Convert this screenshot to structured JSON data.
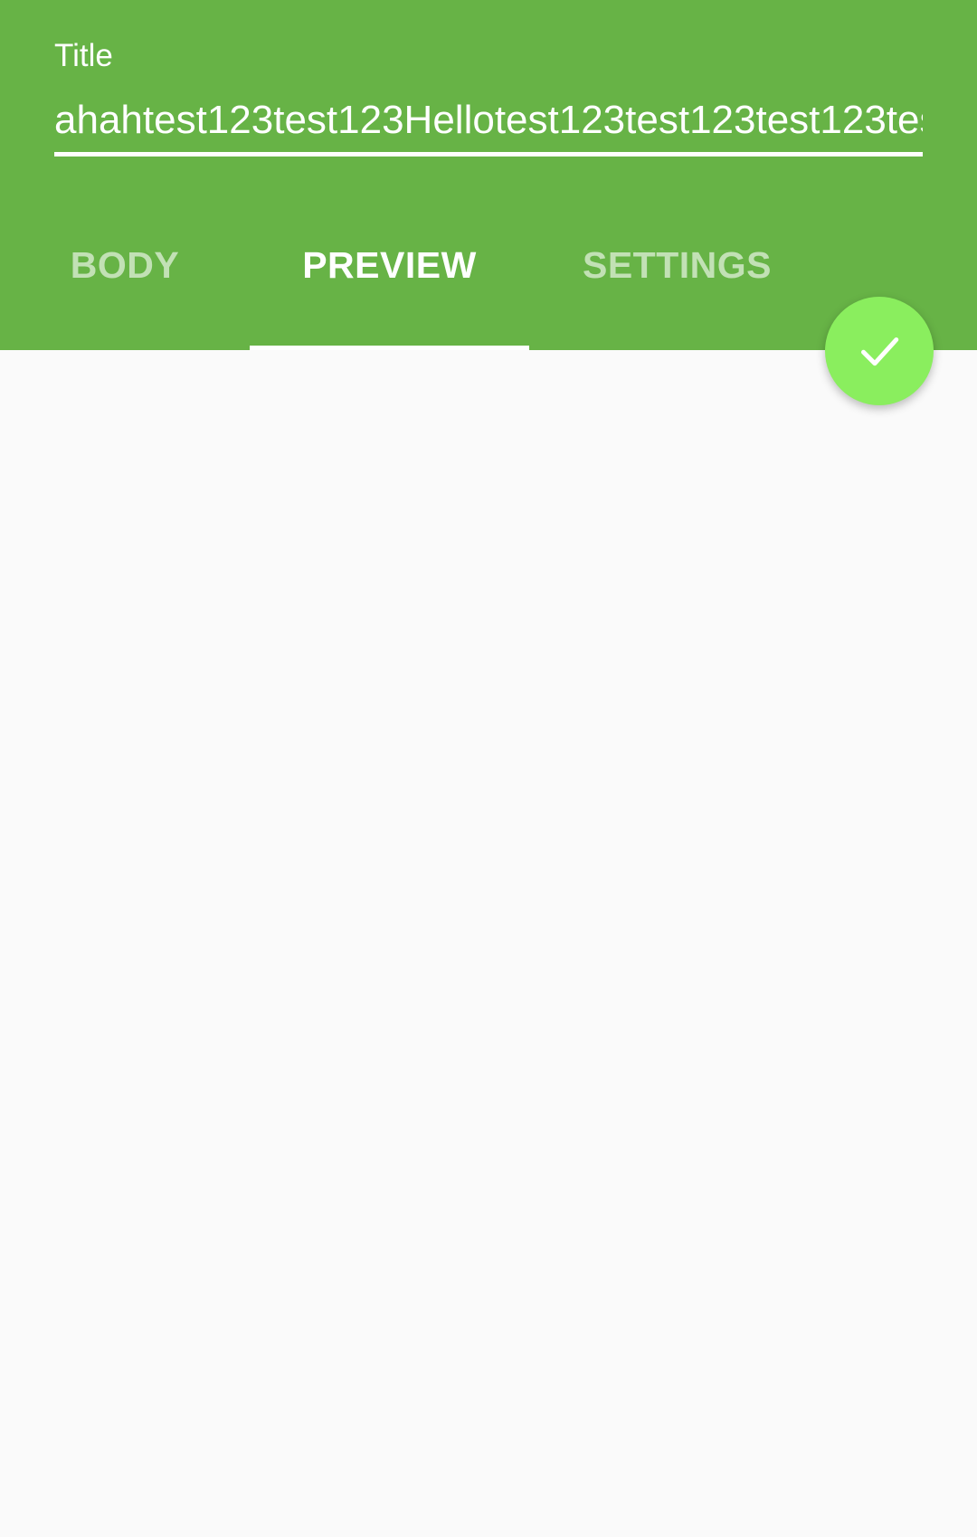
{
  "header": {
    "title_label": "Title",
    "title_value": "ahahtest123test123Hellotest123test123test123tes"
  },
  "tabs": [
    {
      "label": "BODY",
      "active": false
    },
    {
      "label": "PREVIEW",
      "active": true
    },
    {
      "label": "SETTINGS",
      "active": false
    }
  ],
  "fab": {
    "icon": "check-icon"
  },
  "colors": {
    "primary": "#67b346",
    "accent": "#8aee5e",
    "background": "#fafafa"
  }
}
